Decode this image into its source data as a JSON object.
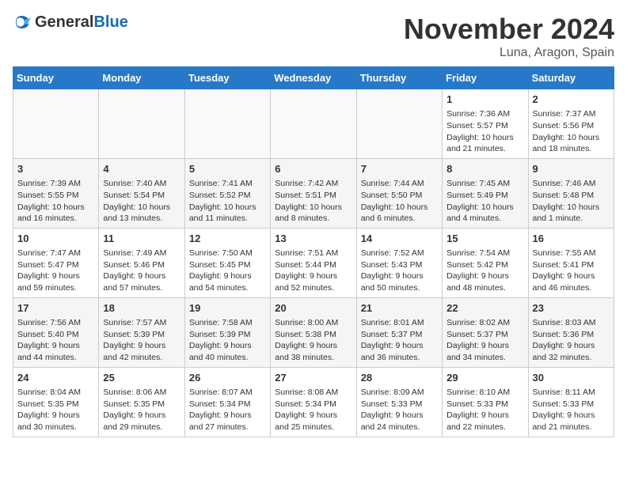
{
  "header": {
    "logo_general": "General",
    "logo_blue": "Blue",
    "month_year": "November 2024",
    "location": "Luna, Aragon, Spain"
  },
  "weekdays": [
    "Sunday",
    "Monday",
    "Tuesday",
    "Wednesday",
    "Thursday",
    "Friday",
    "Saturday"
  ],
  "weeks": [
    [
      {
        "day": "",
        "info": ""
      },
      {
        "day": "",
        "info": ""
      },
      {
        "day": "",
        "info": ""
      },
      {
        "day": "",
        "info": ""
      },
      {
        "day": "",
        "info": ""
      },
      {
        "day": "1",
        "info": "Sunrise: 7:36 AM\nSunset: 5:57 PM\nDaylight: 10 hours\nand 21 minutes."
      },
      {
        "day": "2",
        "info": "Sunrise: 7:37 AM\nSunset: 5:56 PM\nDaylight: 10 hours\nand 18 minutes."
      }
    ],
    [
      {
        "day": "3",
        "info": "Sunrise: 7:39 AM\nSunset: 5:55 PM\nDaylight: 10 hours\nand 16 minutes."
      },
      {
        "day": "4",
        "info": "Sunrise: 7:40 AM\nSunset: 5:54 PM\nDaylight: 10 hours\nand 13 minutes."
      },
      {
        "day": "5",
        "info": "Sunrise: 7:41 AM\nSunset: 5:52 PM\nDaylight: 10 hours\nand 11 minutes."
      },
      {
        "day": "6",
        "info": "Sunrise: 7:42 AM\nSunset: 5:51 PM\nDaylight: 10 hours\nand 8 minutes."
      },
      {
        "day": "7",
        "info": "Sunrise: 7:44 AM\nSunset: 5:50 PM\nDaylight: 10 hours\nand 6 minutes."
      },
      {
        "day": "8",
        "info": "Sunrise: 7:45 AM\nSunset: 5:49 PM\nDaylight: 10 hours\nand 4 minutes."
      },
      {
        "day": "9",
        "info": "Sunrise: 7:46 AM\nSunset: 5:48 PM\nDaylight: 10 hours\nand 1 minute."
      }
    ],
    [
      {
        "day": "10",
        "info": "Sunrise: 7:47 AM\nSunset: 5:47 PM\nDaylight: 9 hours\nand 59 minutes."
      },
      {
        "day": "11",
        "info": "Sunrise: 7:49 AM\nSunset: 5:46 PM\nDaylight: 9 hours\nand 57 minutes."
      },
      {
        "day": "12",
        "info": "Sunrise: 7:50 AM\nSunset: 5:45 PM\nDaylight: 9 hours\nand 54 minutes."
      },
      {
        "day": "13",
        "info": "Sunrise: 7:51 AM\nSunset: 5:44 PM\nDaylight: 9 hours\nand 52 minutes."
      },
      {
        "day": "14",
        "info": "Sunrise: 7:52 AM\nSunset: 5:43 PM\nDaylight: 9 hours\nand 50 minutes."
      },
      {
        "day": "15",
        "info": "Sunrise: 7:54 AM\nSunset: 5:42 PM\nDaylight: 9 hours\nand 48 minutes."
      },
      {
        "day": "16",
        "info": "Sunrise: 7:55 AM\nSunset: 5:41 PM\nDaylight: 9 hours\nand 46 minutes."
      }
    ],
    [
      {
        "day": "17",
        "info": "Sunrise: 7:56 AM\nSunset: 5:40 PM\nDaylight: 9 hours\nand 44 minutes."
      },
      {
        "day": "18",
        "info": "Sunrise: 7:57 AM\nSunset: 5:39 PM\nDaylight: 9 hours\nand 42 minutes."
      },
      {
        "day": "19",
        "info": "Sunrise: 7:58 AM\nSunset: 5:39 PM\nDaylight: 9 hours\nand 40 minutes."
      },
      {
        "day": "20",
        "info": "Sunrise: 8:00 AM\nSunset: 5:38 PM\nDaylight: 9 hours\nand 38 minutes."
      },
      {
        "day": "21",
        "info": "Sunrise: 8:01 AM\nSunset: 5:37 PM\nDaylight: 9 hours\nand 36 minutes."
      },
      {
        "day": "22",
        "info": "Sunrise: 8:02 AM\nSunset: 5:37 PM\nDaylight: 9 hours\nand 34 minutes."
      },
      {
        "day": "23",
        "info": "Sunrise: 8:03 AM\nSunset: 5:36 PM\nDaylight: 9 hours\nand 32 minutes."
      }
    ],
    [
      {
        "day": "24",
        "info": "Sunrise: 8:04 AM\nSunset: 5:35 PM\nDaylight: 9 hours\nand 30 minutes."
      },
      {
        "day": "25",
        "info": "Sunrise: 8:06 AM\nSunset: 5:35 PM\nDaylight: 9 hours\nand 29 minutes."
      },
      {
        "day": "26",
        "info": "Sunrise: 8:07 AM\nSunset: 5:34 PM\nDaylight: 9 hours\nand 27 minutes."
      },
      {
        "day": "27",
        "info": "Sunrise: 8:08 AM\nSunset: 5:34 PM\nDaylight: 9 hours\nand 25 minutes."
      },
      {
        "day": "28",
        "info": "Sunrise: 8:09 AM\nSunset: 5:33 PM\nDaylight: 9 hours\nand 24 minutes."
      },
      {
        "day": "29",
        "info": "Sunrise: 8:10 AM\nSunset: 5:33 PM\nDaylight: 9 hours\nand 22 minutes."
      },
      {
        "day": "30",
        "info": "Sunrise: 8:11 AM\nSunset: 5:33 PM\nDaylight: 9 hours\nand 21 minutes."
      }
    ]
  ]
}
